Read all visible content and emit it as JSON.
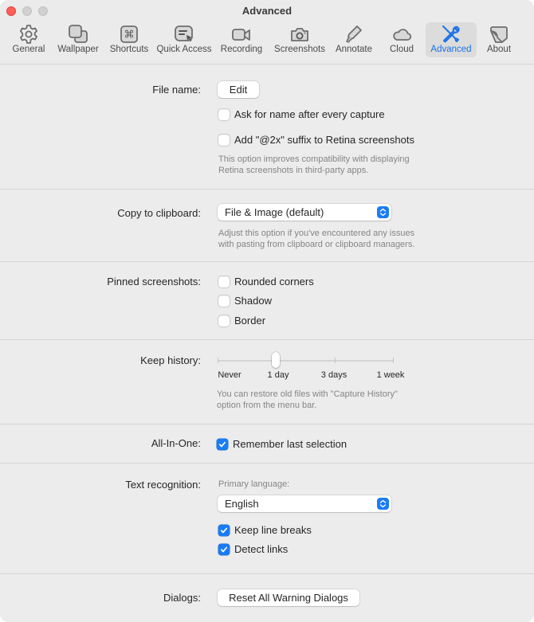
{
  "window": {
    "title": "Advanced"
  },
  "toolbar": {
    "tabs": [
      {
        "label": "General",
        "icon": "gear-icon"
      },
      {
        "label": "Wallpaper",
        "icon": "wallpaper-icon"
      },
      {
        "label": "Shortcuts",
        "icon": "command-key-icon"
      },
      {
        "label": "Quick Access",
        "icon": "quick-access-icon"
      },
      {
        "label": "Recording",
        "icon": "video-camera-icon"
      },
      {
        "label": "Screenshots",
        "icon": "camera-icon"
      },
      {
        "label": "Annotate",
        "icon": "highlighter-icon"
      },
      {
        "label": "Cloud",
        "icon": "cloud-icon"
      },
      {
        "label": "Advanced",
        "icon": "wrench-screwdriver-icon",
        "active": true
      },
      {
        "label": "About",
        "icon": "about-icon"
      }
    ],
    "accent_color": "#1a73e8"
  },
  "file_name": {
    "label": "File name:",
    "edit_button": "Edit",
    "ask_name": {
      "label": "Ask for name after every capture",
      "checked": false
    },
    "retina_suffix": {
      "label": "Add \"@2x\" suffix to Retina screenshots",
      "checked": false
    },
    "help_line1": "This option improves compatibility with displaying",
    "help_line2": "Retina screenshots in third-party apps."
  },
  "clipboard": {
    "label": "Copy to clipboard:",
    "selected": "File & Image (default)",
    "help_line1": "Adjust this option if you've encountered any issues",
    "help_line2": "with pasting from clipboard or clipboard managers."
  },
  "pinned": {
    "label": "Pinned screenshots:",
    "options": [
      {
        "label": "Rounded corners",
        "checked": false
      },
      {
        "label": "Shadow",
        "checked": false
      },
      {
        "label": "Border",
        "checked": false
      }
    ]
  },
  "history": {
    "label": "Keep history:",
    "ticks": [
      "Never",
      "1 day",
      "3 days",
      "1 week"
    ],
    "selected_index": 1,
    "help_line1": "You can restore old files with \"Capture History\"",
    "help_line2": "option from the menu bar."
  },
  "all_in_one": {
    "label": "All-In-One:",
    "remember": {
      "label": "Remember last selection",
      "checked": true
    }
  },
  "text_recognition": {
    "label": "Text recognition:",
    "primary_language_label": "Primary language:",
    "language": "English",
    "keep_line_breaks": {
      "label": "Keep line breaks",
      "checked": true
    },
    "detect_links": {
      "label": "Detect links",
      "checked": true
    }
  },
  "dialogs": {
    "label": "Dialogs:",
    "reset_button": "Reset All Warning Dialogs"
  }
}
